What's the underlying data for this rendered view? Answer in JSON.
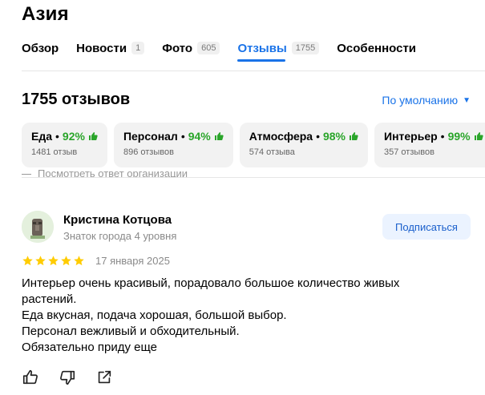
{
  "place": {
    "title": "Азия"
  },
  "tabs": [
    {
      "label": "Обзор",
      "count": ""
    },
    {
      "label": "Новости",
      "count": "1"
    },
    {
      "label": "Фото",
      "count": "605"
    },
    {
      "label": "Отзывы",
      "count": "1755"
    },
    {
      "label": "Особенности",
      "count": ""
    }
  ],
  "reviews": {
    "count_label": "1755 отзывов",
    "sort_label": "По умолчанию",
    "categories": [
      {
        "name": "Еда",
        "percent": "92%",
        "count": "1481 отзыв"
      },
      {
        "name": "Персонал",
        "percent": "94%",
        "count": "896 отзывов"
      },
      {
        "name": "Атмосфера",
        "percent": "98%",
        "count": "574 отзыва"
      },
      {
        "name": "Интерьер",
        "percent": "99%",
        "count": "357 отзывов"
      }
    ],
    "prev_reply_label": "Посмотреть ответ организации"
  },
  "review": {
    "author": "Кристина Котцова",
    "author_level": "Знаток города 4 уровня",
    "subscribe_label": "Подписаться",
    "rating": 5,
    "date": "17 января 2025",
    "lines": [
      "Интерьер очень красивый, порадовало большое количество живых растений.",
      "Еда вкусная, подача хорошая, большой выбор.",
      "Персонал вежливый и обходительный.",
      "Обязательно приду еще"
    ]
  },
  "colors": {
    "accent": "#1a73e8",
    "positive": "#2aa52a",
    "star": "#fc0"
  },
  "icons": [
    "thumb-up-icon",
    "like-icon",
    "dislike-icon",
    "share-icon",
    "star-icon",
    "caret-down-icon"
  ]
}
